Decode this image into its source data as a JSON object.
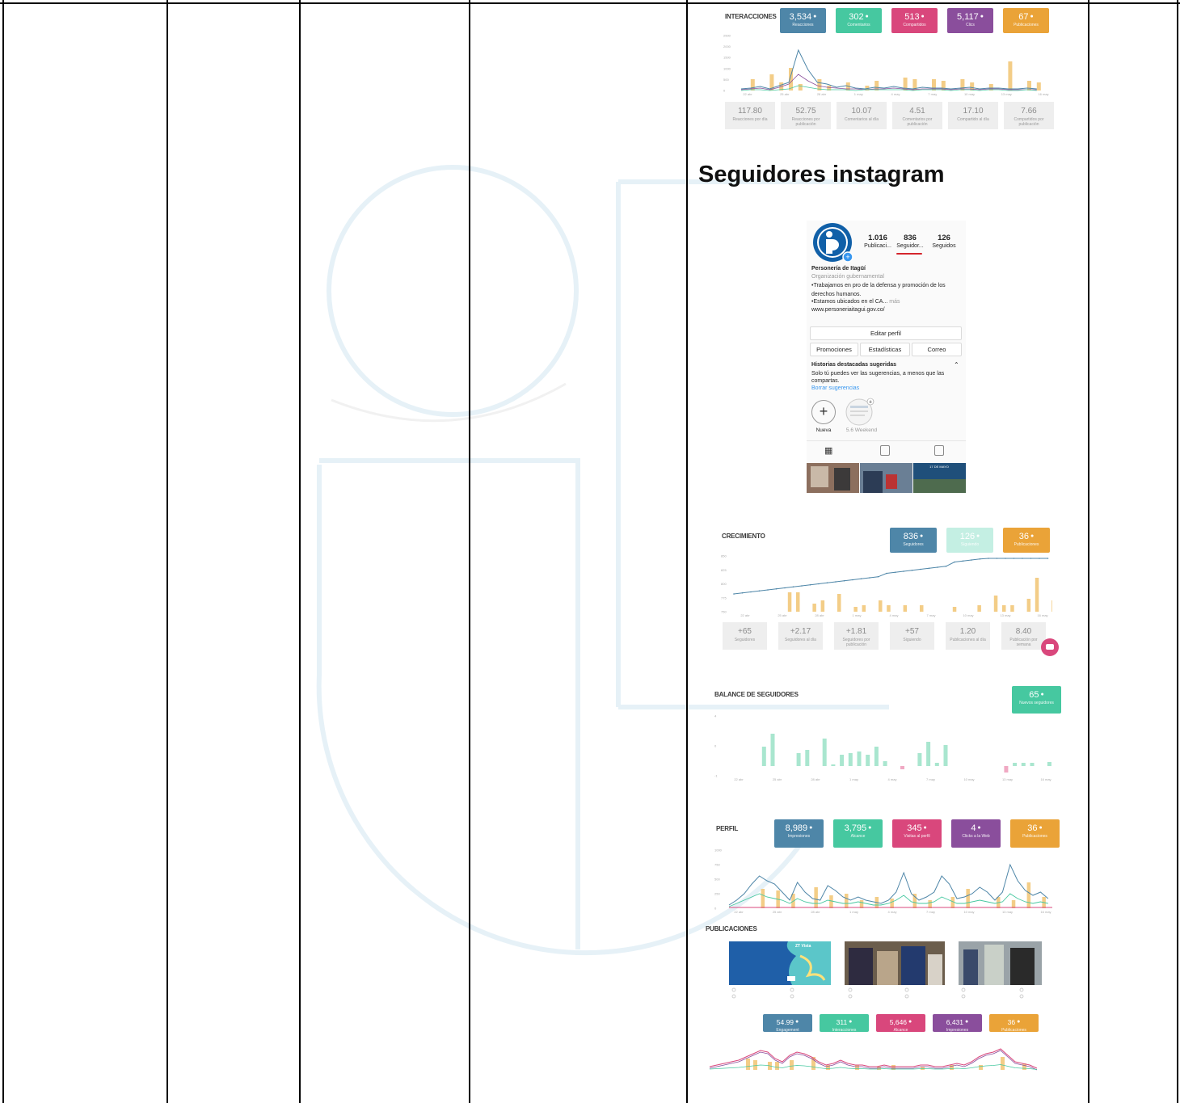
{
  "section_title": "Seguidores instagram",
  "colors": {
    "blue": "#4e86a8",
    "teal": "#46c8a0",
    "pink": "#d9477c",
    "purple": "#8a4e9c",
    "orange": "#eaa338",
    "light_teal": "#c4efe3",
    "bar_orange": "#f3cd87",
    "bar_teal": "#a9e6cf",
    "bar_pink": "#f0a9c3"
  },
  "interacciones": {
    "title": "INTERACCIONES",
    "badges": [
      {
        "value": "3,534",
        "label": "Reacciones",
        "color": "#4e86a8"
      },
      {
        "value": "302",
        "label": "Comentarios",
        "color": "#46c8a0"
      },
      {
        "value": "513",
        "label": "Compartidos",
        "color": "#d9477c"
      },
      {
        "value": "5,117",
        "label": "Clics",
        "color": "#8a4e9c"
      },
      {
        "value": "67",
        "label": "Publicaciones",
        "color": "#eaa338"
      }
    ],
    "stats": [
      {
        "value": "117.80",
        "label": "Reacciones por día"
      },
      {
        "value": "52.75",
        "label": "Reacciones por publicación"
      },
      {
        "value": "10.07",
        "label": "Comentarios al día"
      },
      {
        "value": "4.51",
        "label": "Comentarios por publicación"
      },
      {
        "value": "17.10",
        "label": "Compartido al día"
      },
      {
        "value": "7.66",
        "label": "Compartidos por publicación"
      }
    ],
    "y_ticks": [
      "2500",
      "2000",
      "1500",
      "1000",
      "500",
      "0"
    ],
    "x_ticks": [
      "22 abr",
      "25 abr",
      "28 abr",
      "1 may",
      "4 may",
      "7 may",
      "10 may",
      "13 may",
      "16 may"
    ]
  },
  "instagram_profile": {
    "posts_count": "1.016",
    "posts_label": "Publicaci...",
    "followers_count": "836",
    "followers_label": "Seguidor...",
    "following_count": "126",
    "following_label": "Seguidos",
    "name": "Personería de Itagüí",
    "category": "Organización gubernamental",
    "bio_1": "•Trabajamos en pro de la defensa y promoción de los derechos humanos.",
    "bio_2": "•Estamos ubicados en el CA...",
    "more": "más",
    "website": "www.personeriaitagui.gov.co/",
    "edit_profile": "Editar perfil",
    "promotions": "Promociones",
    "statistics": "Estadísticas",
    "mail": "Correo",
    "highlights_title": "Historias destacadas sugeridas",
    "highlights_text": "Solo tú puedes ver las sugerencias, a menos que las compartas.",
    "clear_suggestions": "Borrar sugerencias",
    "new_label": "Nueva",
    "weekend_label": "5.6 Weekend",
    "post_caption": "17 DE MAYO"
  },
  "crecimiento": {
    "title": "CRECIMIENTO",
    "badges": [
      {
        "value": "836",
        "label": "Seguidores",
        "color": "#4e86a8"
      },
      {
        "value": "126",
        "label": "Siguiendo",
        "color": "#c4efe3"
      },
      {
        "value": "36",
        "label": "Publicaciones",
        "color": "#eaa338"
      }
    ],
    "stats": [
      {
        "value": "+65",
        "label": "Seguidores"
      },
      {
        "value": "+2.17",
        "label": "Seguidores al día"
      },
      {
        "value": "+1.81",
        "label": "Seguidores por publicación"
      },
      {
        "value": "+57",
        "label": "Siguiendo"
      },
      {
        "value": "1.20",
        "label": "Publicaciones al día"
      },
      {
        "value": "8.40",
        "label": "Publicación por semana"
      }
    ],
    "y_ticks": [
      "850",
      "825",
      "800",
      "775",
      "750"
    ],
    "x_ticks": [
      "22 abr",
      "25 abr",
      "28 abr",
      "1 may",
      "4 may",
      "7 may",
      "10 may",
      "13 may",
      "16 may"
    ]
  },
  "balance": {
    "title": "BALANCE DE SEGUIDORES",
    "badge": {
      "value": "65",
      "label": "Nuevos seguidores",
      "color": "#46c8a0"
    },
    "y_ticks": [
      "4",
      "0",
      "-1"
    ],
    "x_ticks": [
      "22 abr",
      "25 abr",
      "28 abr",
      "1 may",
      "4 may",
      "7 may",
      "10 may",
      "13 may",
      "16 may"
    ]
  },
  "perfil": {
    "title": "PERFIL",
    "badges": [
      {
        "value": "8,989",
        "label": "Impresiones",
        "color": "#4e86a8"
      },
      {
        "value": "3,795",
        "label": "Alcance",
        "color": "#46c8a0"
      },
      {
        "value": "345",
        "label": "Visitas al perfil",
        "color": "#d9477c"
      },
      {
        "value": "4",
        "label": "Clicks a la Web",
        "color": "#8a4e9c"
      },
      {
        "value": "36",
        "label": "Publicaciones",
        "color": "#eaa338"
      }
    ],
    "y_ticks": [
      "1000",
      "750",
      "500",
      "250",
      "0"
    ],
    "x_ticks": [
      "22 abr",
      "25 abr",
      "28 abr",
      "1 may",
      "4 may",
      "7 may",
      "10 may",
      "13 may",
      "16 may"
    ]
  },
  "publicaciones": {
    "title": "PUBLICACIONES",
    "thumb_caption": "ZT Vista",
    "badges": [
      {
        "value": "54.99",
        "label": "Engagement",
        "color": "#4e86a8"
      },
      {
        "value": "311",
        "label": "Interacciones",
        "color": "#46c8a0"
      },
      {
        "value": "5,646",
        "label": "Alcance",
        "color": "#d9477c"
      },
      {
        "value": "6,431",
        "label": "Impresiones",
        "color": "#8a4e9c"
      },
      {
        "value": "36",
        "label": "Publicaciones",
        "color": "#eaa338"
      }
    ]
  }
}
